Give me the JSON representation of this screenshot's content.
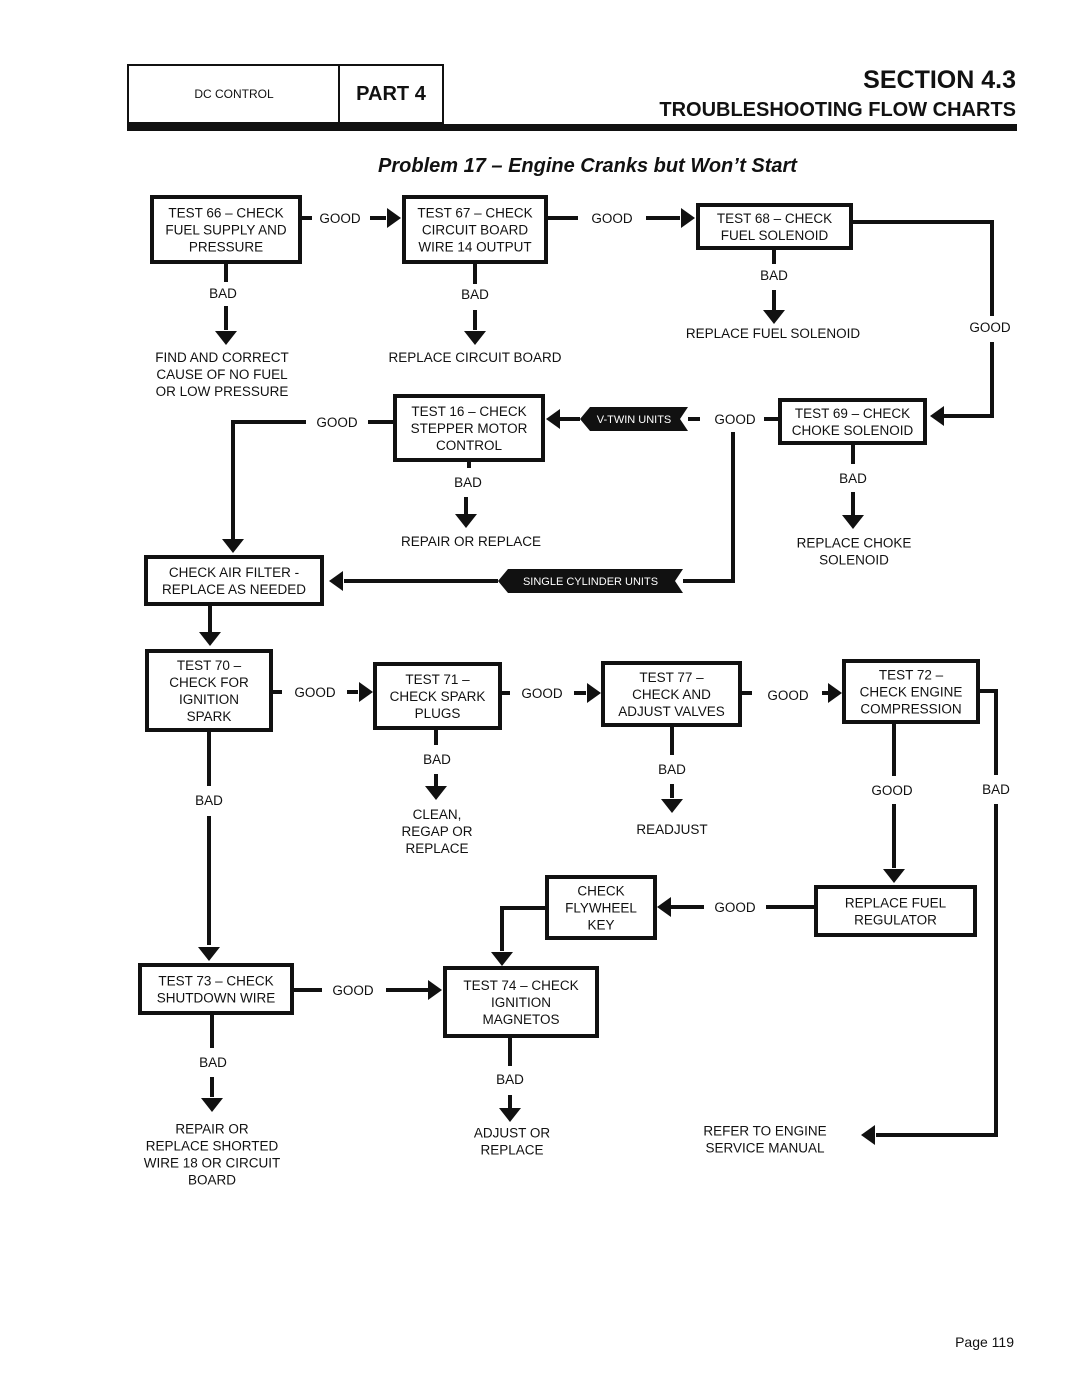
{
  "header": {
    "category": "DC CONTROL",
    "part": "PART 4",
    "section": "SECTION 4.3",
    "section_subtitle": "TROUBLESHOOTING FLOW CHARTS"
  },
  "title": "Problem 17 – Engine Cranks but Won’t Start",
  "page": "Page 119",
  "labels": {
    "good": "GOOD",
    "bad": "BAD"
  },
  "banners": {
    "vtwin": "V-TWIN UNITS",
    "single": "SINGLE CYLINDER UNITS"
  },
  "nodes": {
    "t66": [
      "TEST 66 – CHECK",
      "FUEL SUPPLY AND",
      "PRESSURE"
    ],
    "t67": [
      "TEST 67 – CHECK",
      "CIRCUIT BOARD",
      "WIRE 14 OUTPUT"
    ],
    "t68": [
      "TEST 68 – CHECK",
      "FUEL SOLENOID"
    ],
    "t16": [
      "TEST 16 – CHECK",
      "STEPPER MOTOR",
      "CONTROL"
    ],
    "t69": [
      "TEST 69 – CHECK",
      "CHOKE SOLENOID"
    ],
    "air": [
      "CHECK AIR FILTER -",
      "REPLACE AS NEEDED"
    ],
    "t70": [
      "TEST 70 –",
      "CHECK FOR",
      "IGNITION",
      "SPARK"
    ],
    "t71": [
      "TEST 71 –",
      "CHECK SPARK",
      "PLUGS"
    ],
    "t77": [
      "TEST 77 –",
      "CHECK AND",
      "ADJUST VALVES"
    ],
    "t72": [
      "TEST 72 –",
      "CHECK ENGINE",
      "COMPRESSION"
    ],
    "fly": [
      "CHECK",
      "FLYWHEEL",
      "KEY"
    ],
    "reg": [
      "REPLACE FUEL",
      "REGULATOR"
    ],
    "t73": [
      "TEST 73 – CHECK",
      "SHUTDOWN WIRE"
    ],
    "t74": [
      "TEST 74 – CHECK",
      "IGNITION",
      "MAGNETOS"
    ]
  },
  "outcomes": {
    "nofuel": [
      "FIND AND CORRECT",
      "CAUSE OF NO FUEL",
      "OR LOW PRESSURE"
    ],
    "board": [
      "REPLACE CIRCUIT BOARD"
    ],
    "solenoid": [
      "REPLACE FUEL SOLENOID"
    ],
    "stepper": [
      "REPAIR OR REPLACE"
    ],
    "choke": [
      "REPLACE CHOKE",
      "SOLENOID"
    ],
    "plugs": [
      "CLEAN,",
      "REGAP OR",
      "REPLACE"
    ],
    "valves": [
      "READJUST"
    ],
    "wire18": [
      "REPAIR OR",
      "REPLACE SHORTED",
      "WIRE 18 OR CIRCUIT",
      "BOARD"
    ],
    "magnetos": [
      "ADJUST OR",
      "REPLACE"
    ],
    "engine": [
      "REFER TO ENGINE",
      "SERVICE MANUAL"
    ]
  }
}
